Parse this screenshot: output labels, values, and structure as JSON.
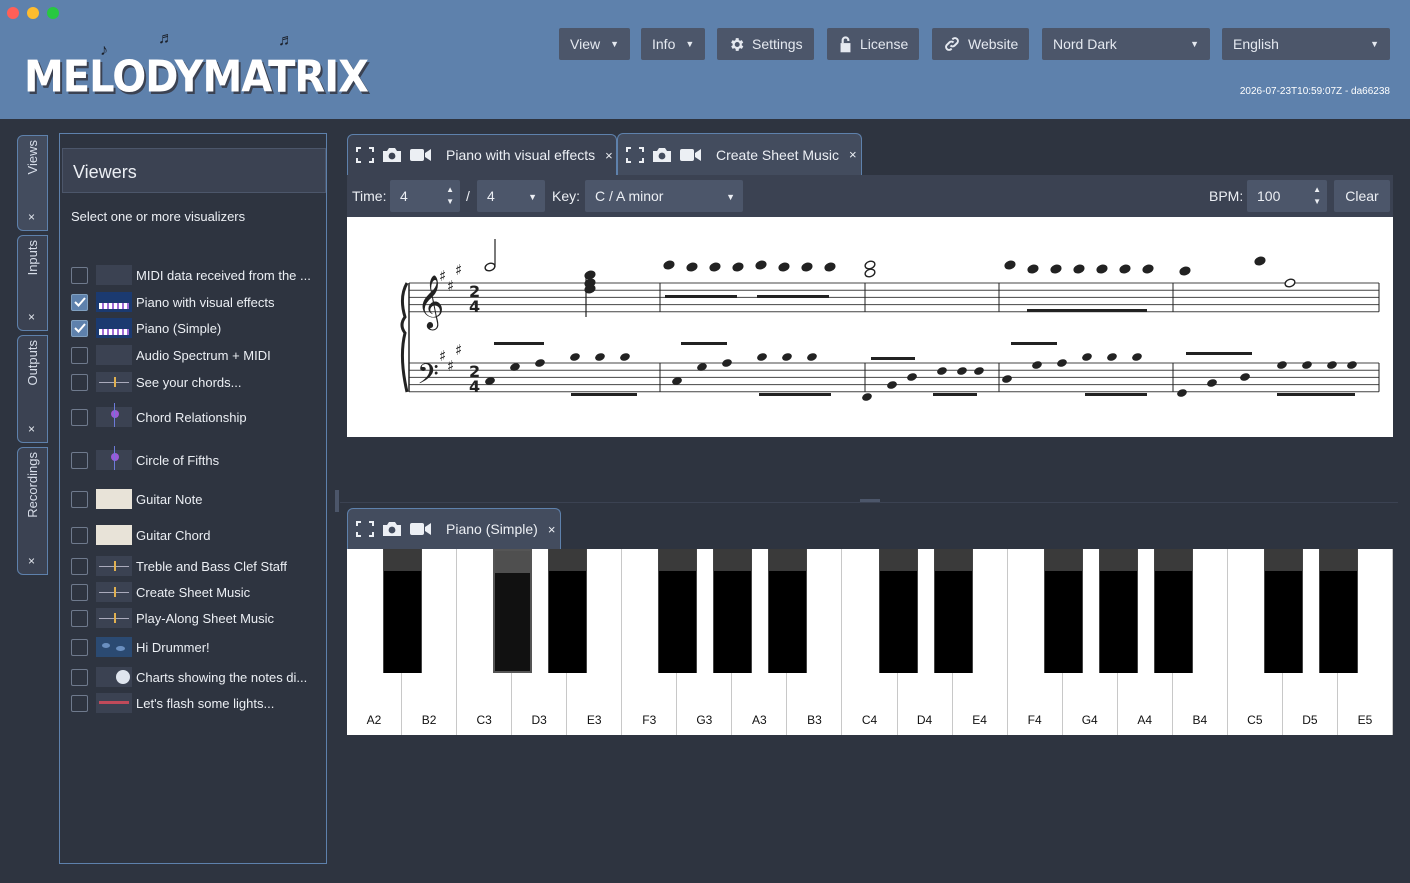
{
  "app": {
    "name": "MELODYMATRIX",
    "build": "2026-07-23T10:59:07Z - da66238"
  },
  "header": {
    "view_label": "View",
    "info_label": "Info",
    "settings_label": "Settings",
    "license_label": "License",
    "website_label": "Website",
    "theme_value": "Nord Dark",
    "language_value": "English"
  },
  "side_tabs": {
    "views": "Views",
    "inputs": "Inputs",
    "outputs": "Outputs",
    "recordings": "Recordings",
    "close": "×"
  },
  "viewers": {
    "title": "Viewers",
    "subtitle": "Select one or more visualizers",
    "items": [
      {
        "label": "MIDI data received from the ...",
        "checked": false
      },
      {
        "label": "Piano with visual effects",
        "checked": true
      },
      {
        "label": "Piano (Simple)",
        "checked": true
      },
      {
        "label": "Audio Spectrum + MIDI",
        "checked": false
      },
      {
        "label": "See your chords...",
        "checked": false
      },
      {
        "label": "Chord Relationship",
        "checked": false
      },
      {
        "label": "Circle of Fifths",
        "checked": false
      },
      {
        "label": "Guitar Note",
        "checked": false
      },
      {
        "label": "Guitar Chord",
        "checked": false
      },
      {
        "label": "Treble and Bass Clef Staff",
        "checked": false
      },
      {
        "label": "Create Sheet Music",
        "checked": false
      },
      {
        "label": "Play-Along Sheet Music",
        "checked": false
      },
      {
        "label": "Hi Drummer!",
        "checked": false
      },
      {
        "label": "Charts showing the notes di...",
        "checked": false
      },
      {
        "label": "Let's flash some lights...",
        "checked": false
      }
    ]
  },
  "top_panel": {
    "tabs": [
      {
        "label": "Piano with visual effects",
        "close": "×"
      },
      {
        "label": "Create Sheet Music",
        "close": "×"
      }
    ],
    "toolbar": {
      "time_label": "Time:",
      "time_num": "4",
      "slash": "/",
      "time_den": "4",
      "key_label": "Key:",
      "key_value": "C / A minor",
      "bpm_label": "BPM:",
      "bpm_value": "100",
      "clear_label": "Clear"
    },
    "sheet": {
      "time_signature_top": "2",
      "time_signature_bottom": "4"
    }
  },
  "bottom_panel": {
    "tab": {
      "label": "Piano (Simple)",
      "close": "×"
    },
    "white_keys": [
      "A2",
      "B2",
      "C3",
      "D3",
      "E3",
      "F3",
      "G3",
      "A3",
      "B3",
      "C4",
      "D4",
      "E4",
      "F4",
      "G4",
      "A4",
      "B4",
      "C5",
      "D5",
      "E5"
    ],
    "pressed_black_key": "C#3"
  },
  "colors": {
    "background": "#2e3440",
    "header": "#5e81ac",
    "button": "#4c566a",
    "accent": "#81a1c1"
  }
}
